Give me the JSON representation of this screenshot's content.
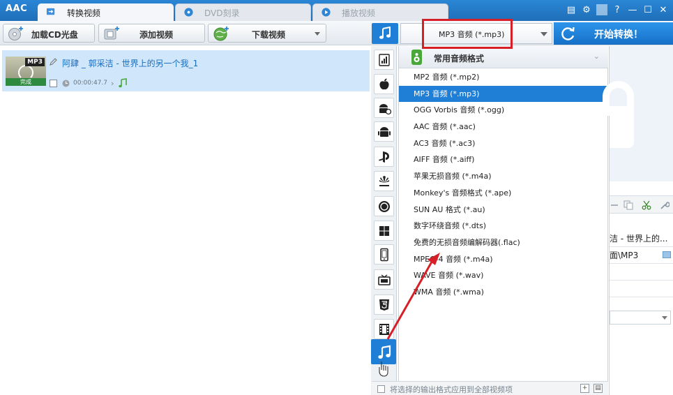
{
  "app": {
    "logo": "AAC",
    "tabs": [
      {
        "label": "转换视频",
        "state": "active",
        "icon": "convert-icon"
      },
      {
        "label": "DVD刻录",
        "state": "inactive",
        "icon": "disc-icon"
      },
      {
        "label": "播放视频",
        "state": "inactive",
        "icon": "play-icon"
      }
    ],
    "window_controls": {
      "menu": "▤",
      "settings": "⚙",
      "help": "?",
      "minimize": "—",
      "maximize": "☐",
      "close": "✕"
    }
  },
  "toolbar": {
    "load_cd_label": "加载CD光盘",
    "add_video_label": "添加视频",
    "download_video_label": "下载视频",
    "selected_format": "MP3 音频 (*.mp3)",
    "start_label": "开始转换！"
  },
  "file_list": {
    "items": [
      {
        "title": "阿肆 _ 郭采洁 - 世界上的另一个我_1",
        "badge": "MP3",
        "status": "完成",
        "duration": "00:00:47.7"
      }
    ]
  },
  "categories": [
    {
      "name": "audio-bars"
    },
    {
      "name": "apple"
    },
    {
      "name": "android-settings"
    },
    {
      "name": "android"
    },
    {
      "name": "playstation"
    },
    {
      "name": "huawei"
    },
    {
      "name": "lg"
    },
    {
      "name": "windows"
    },
    {
      "name": "phone"
    },
    {
      "name": "tv"
    },
    {
      "name": "html5"
    },
    {
      "name": "film"
    },
    {
      "name": "music",
      "selected": true
    }
  ],
  "format_panel": {
    "header": "常用音频格式",
    "items": [
      {
        "label": "MP2 音频 (*.mp2)"
      },
      {
        "label": "MP3 音频 (*.mp3)",
        "selected": true
      },
      {
        "label": "OGG Vorbis 音频 (*.ogg)"
      },
      {
        "label": "AAC 音频 (*.aac)"
      },
      {
        "label": "AC3 音频 (*.ac3)"
      },
      {
        "label": "AIFF 音频 (*.aiff)"
      },
      {
        "label": "苹果无损音频 (*.m4a)"
      },
      {
        "label": "Monkey's 音频格式 (*.ape)"
      },
      {
        "label": "SUN AU 格式 (*.au)"
      },
      {
        "label": "数字环绕音频 (*.dts)"
      },
      {
        "label": "免费的无损音频编解码器(.flac)"
      },
      {
        "label": "MPEG-4 音频 (*.m4a)"
      },
      {
        "label": "WAVE 音频 (*.wav)"
      },
      {
        "label": "WMA 音频 (*.wma)"
      }
    ],
    "footer_label": "将选择的输出格式应用到全部视频项",
    "footer_btn_add": "+",
    "footer_btn_save": "▤"
  },
  "right_panel": {
    "row_title": "洁 - 世界上的...",
    "row_path": "面\\MP3"
  },
  "colors": {
    "accent": "#1f7fd6",
    "highlight": "#d61f26",
    "selected_row": "#cfe6fb"
  }
}
